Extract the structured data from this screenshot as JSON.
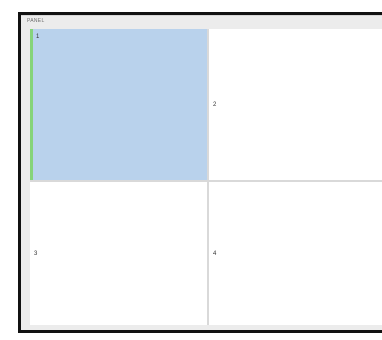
{
  "panel": {
    "title": "PANEL"
  },
  "cells": [
    {
      "label": "1",
      "selected": true
    },
    {
      "label": "2",
      "selected": false
    },
    {
      "label": "3",
      "selected": false
    },
    {
      "label": "4",
      "selected": false
    }
  ],
  "colors": {
    "selected_cell": "#b9d2ec",
    "accent_bar": "#86d47a",
    "window_border": "#111111",
    "panel_background": "#ececec"
  }
}
